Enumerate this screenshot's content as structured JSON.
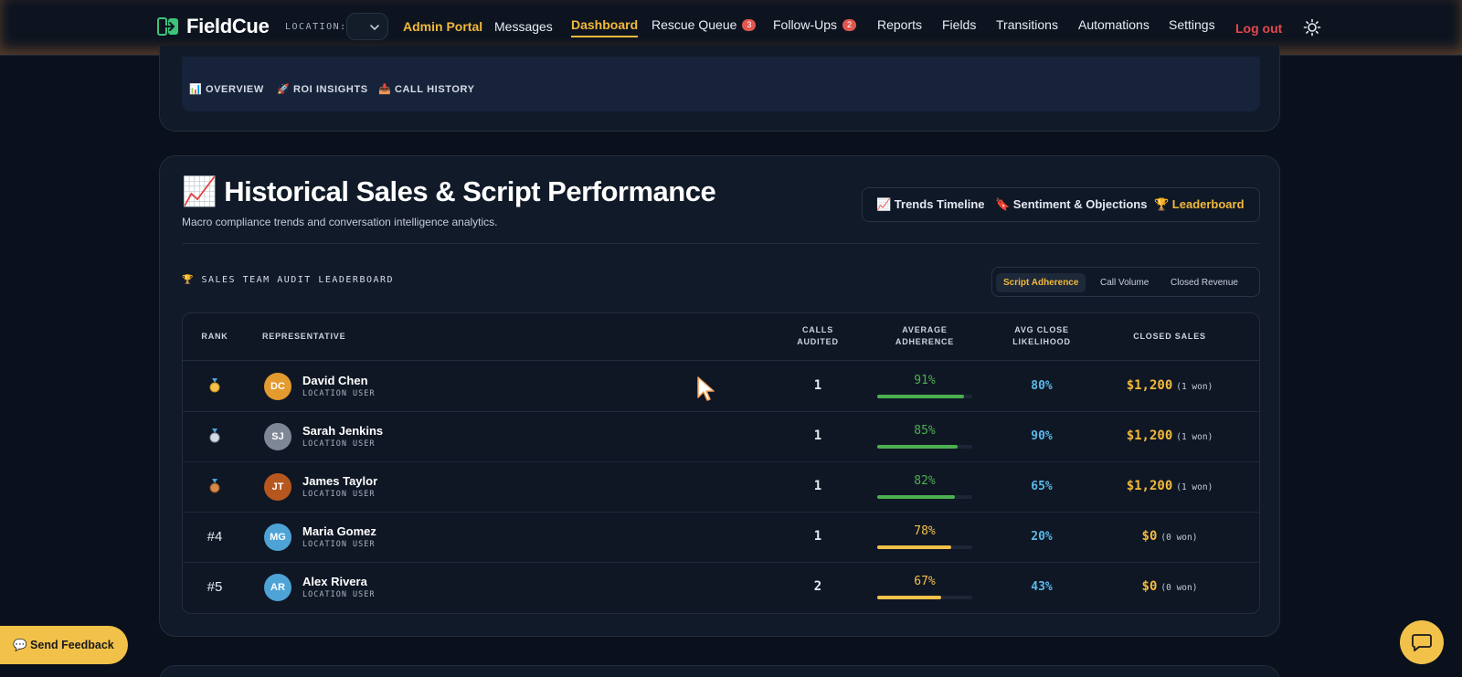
{
  "brand": {
    "name": "FieldCue"
  },
  "location": {
    "label": "LOCATION:",
    "value": ""
  },
  "nav": {
    "admin": "Admin Portal",
    "messages": "Messages",
    "dashboard": "Dashboard",
    "rescue_queue": "Rescue Queue",
    "rescue_count": "3",
    "follow_ups": "Follow-Ups",
    "follow_count": "2",
    "reports": "Reports",
    "fields": "Fields",
    "transitions": "Transitions",
    "automations": "Automations",
    "settings": "Settings",
    "logout": "Log out"
  },
  "subtabs": {
    "overview": "📊 OVERVIEW",
    "roi": "🚀 ROI INSIGHTS",
    "history": "📥 CALL HISTORY"
  },
  "section": {
    "title": "📈 Historical Sales & Script Performance",
    "subtitle": "Macro compliance trends and conversation intelligence analytics."
  },
  "view_tabs": {
    "trends": "📈 Trends Timeline",
    "sentiment": "🔖 Sentiment & Objections",
    "leaderboard": "🏆 Leaderboard"
  },
  "leaderboard": {
    "title": "🏆 SALES TEAM AUDIT LEADERBOARD",
    "metric_tabs": {
      "adherence": "Script Adherence",
      "volume": "Call Volume",
      "revenue": "Closed Revenue"
    },
    "headers": {
      "rank": "RANK",
      "rep": "REPRESENTATIVE",
      "calls_1": "CALLS",
      "calls_2": "AUDITED",
      "adh_1": "AVERAGE",
      "adh_2": "ADHERENCE",
      "close_1": "AVG CLOSE",
      "close_2": "LIKELIHOOD",
      "sales": "CLOSED SALES"
    },
    "rows": [
      {
        "rank": "",
        "medal": "gold-medal-icon",
        "initials": "DC",
        "avatar_color": "#e39a2e",
        "name": "David Chen",
        "role": "LOCATION USER",
        "calls": "1",
        "adherence": "91%",
        "adherence_value": 91,
        "adh_color": "#4caf50",
        "close": "80%",
        "sales": "$1,200",
        "won": "(1 won)"
      },
      {
        "rank": "",
        "medal": "silver-medal-icon",
        "initials": "SJ",
        "avatar_color": "#7d8796",
        "name": "Sarah Jenkins",
        "role": "LOCATION USER",
        "calls": "1",
        "adherence": "85%",
        "adherence_value": 85,
        "adh_color": "#4caf50",
        "close": "90%",
        "sales": "$1,200",
        "won": "(1 won)"
      },
      {
        "rank": "",
        "medal": "bronze-medal-icon",
        "initials": "JT",
        "avatar_color": "#b5571f",
        "name": "James Taylor",
        "role": "LOCATION USER",
        "calls": "1",
        "adherence": "82%",
        "adherence_value": 82,
        "adh_color": "#4caf50",
        "close": "65%",
        "sales": "$1,200",
        "won": "(1 won)"
      },
      {
        "rank": "#4",
        "medal": "",
        "initials": "MG",
        "avatar_color": "#4ea3d6",
        "name": "Maria Gomez",
        "role": "LOCATION USER",
        "calls": "1",
        "adherence": "78%",
        "adherence_value": 78,
        "adh_color": "#f2c14a",
        "close": "20%",
        "sales": "$0",
        "won": "(0 won)"
      },
      {
        "rank": "#5",
        "medal": "",
        "initials": "AR",
        "avatar_color": "#4ea3d6",
        "name": "Alex Rivera",
        "role": "LOCATION USER",
        "calls": "2",
        "adherence": "67%",
        "adherence_value": 67,
        "adh_color": "#f2c14a",
        "close": "43%",
        "sales": "$0",
        "won": "(0 won)"
      }
    ]
  },
  "feedback": {
    "label": "💬 Send Feedback"
  },
  "icons": {
    "theme": "sun-icon",
    "chat": "chat-bubble-icon",
    "location_caret": "chevron-down-icon"
  },
  "colors": {
    "accent": "#f2b93b",
    "danger": "#e5484d",
    "likelihood": "#5cb8ea"
  }
}
